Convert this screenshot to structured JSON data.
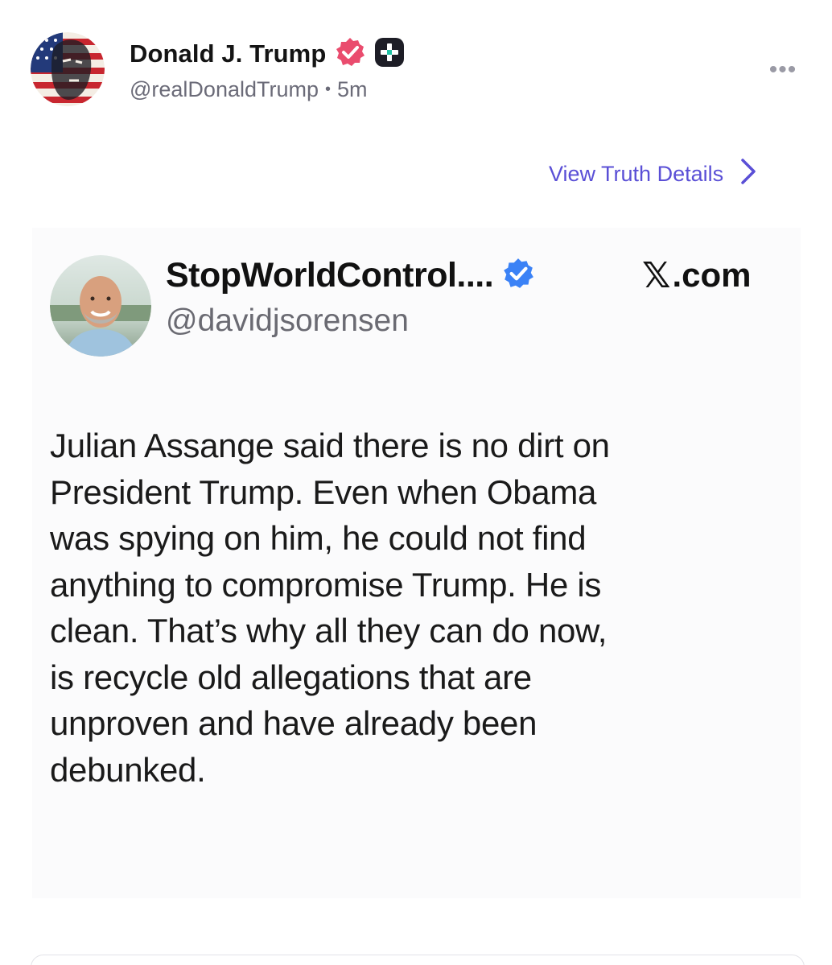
{
  "post": {
    "author_name": "Donald J. Trump",
    "handle": "@realDonaldTrump",
    "separator": "•",
    "time_ago": "5m",
    "more_label": "•••",
    "view_details_label": "View Truth Details",
    "icons": {
      "verified": "verified-badge-icon",
      "plus": "plus-badge-icon",
      "more": "ellipsis-icon",
      "chevron": "chevron-right-icon"
    },
    "colors": {
      "verified_badge": "#ea4c6e",
      "accent_link": "#5a4fd6",
      "embed_verified": "#3b82f6"
    }
  },
  "embed": {
    "name": "StopWorldControl....",
    "handle": "@davidjsorensen",
    "source_logo": "𝕏",
    "source_suffix": ".com",
    "body_lines": [
      "Julian Assange said there is no dirt on",
      "President Trump. Even when Obama",
      "was spying on him, he could not find",
      "anything to compromise Trump. He is",
      "clean. That’s why all they can do now,",
      "is recycle old allegations that are",
      "unproven and have already been",
      "debunked."
    ]
  }
}
